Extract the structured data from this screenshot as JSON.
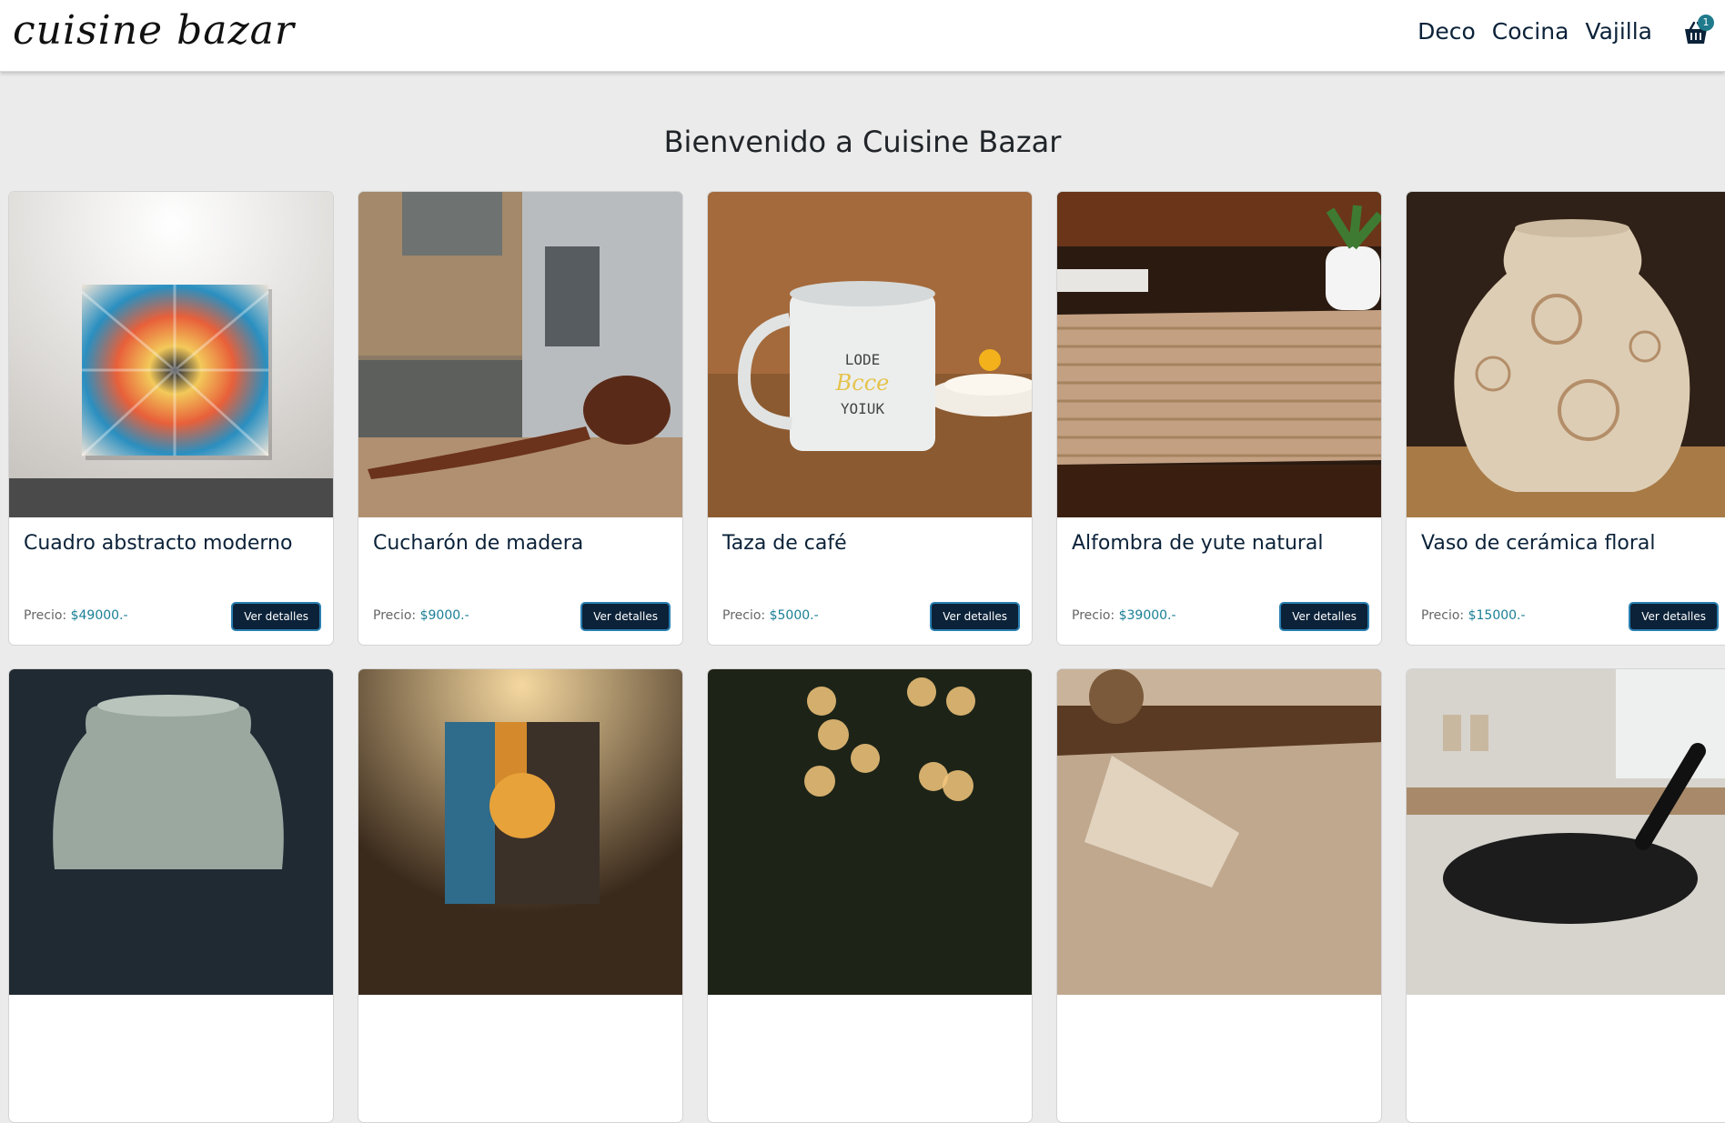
{
  "brand": "cuisine bazar",
  "nav": [
    {
      "label": "Deco"
    },
    {
      "label": "Cocina"
    },
    {
      "label": "Vajilla"
    }
  ],
  "cart": {
    "count": "1"
  },
  "page": {
    "title": "Bienvenido a Cuisine Bazar"
  },
  "price_label": "Precio:",
  "products": [
    {
      "name": "Cuadro abstracto moderno",
      "price": "$49000.-",
      "button": "Ver detalles",
      "image": "abstract-painting-image"
    },
    {
      "name": "Cucharón de madera",
      "price": "$9000.-",
      "button": "Ver detalles",
      "image": "wooden-ladle-image"
    },
    {
      "name": "Taza de café",
      "price": "$5000.-",
      "button": "Ver detalles",
      "image": "coffee-mug-image"
    },
    {
      "name": "Alfombra de yute natural",
      "price": "$39000.-",
      "button": "Ver detalles",
      "image": "jute-rug-image"
    },
    {
      "name": "Vaso de cerámica floral",
      "price": "$15000.-",
      "button": "Ver detalles",
      "image": "ceramic-vase-image"
    },
    {
      "name": "",
      "price": "",
      "button": "",
      "image": "ceramic-jar-image"
    },
    {
      "name": "",
      "price": "",
      "button": "",
      "image": "geometric-art-image"
    },
    {
      "name": "",
      "price": "",
      "button": "",
      "image": "bokeh-lights-image"
    },
    {
      "name": "",
      "price": "",
      "button": "",
      "image": "woven-mat-image"
    },
    {
      "name": "",
      "price": "",
      "button": "",
      "image": "frying-pan-image"
    }
  ]
}
